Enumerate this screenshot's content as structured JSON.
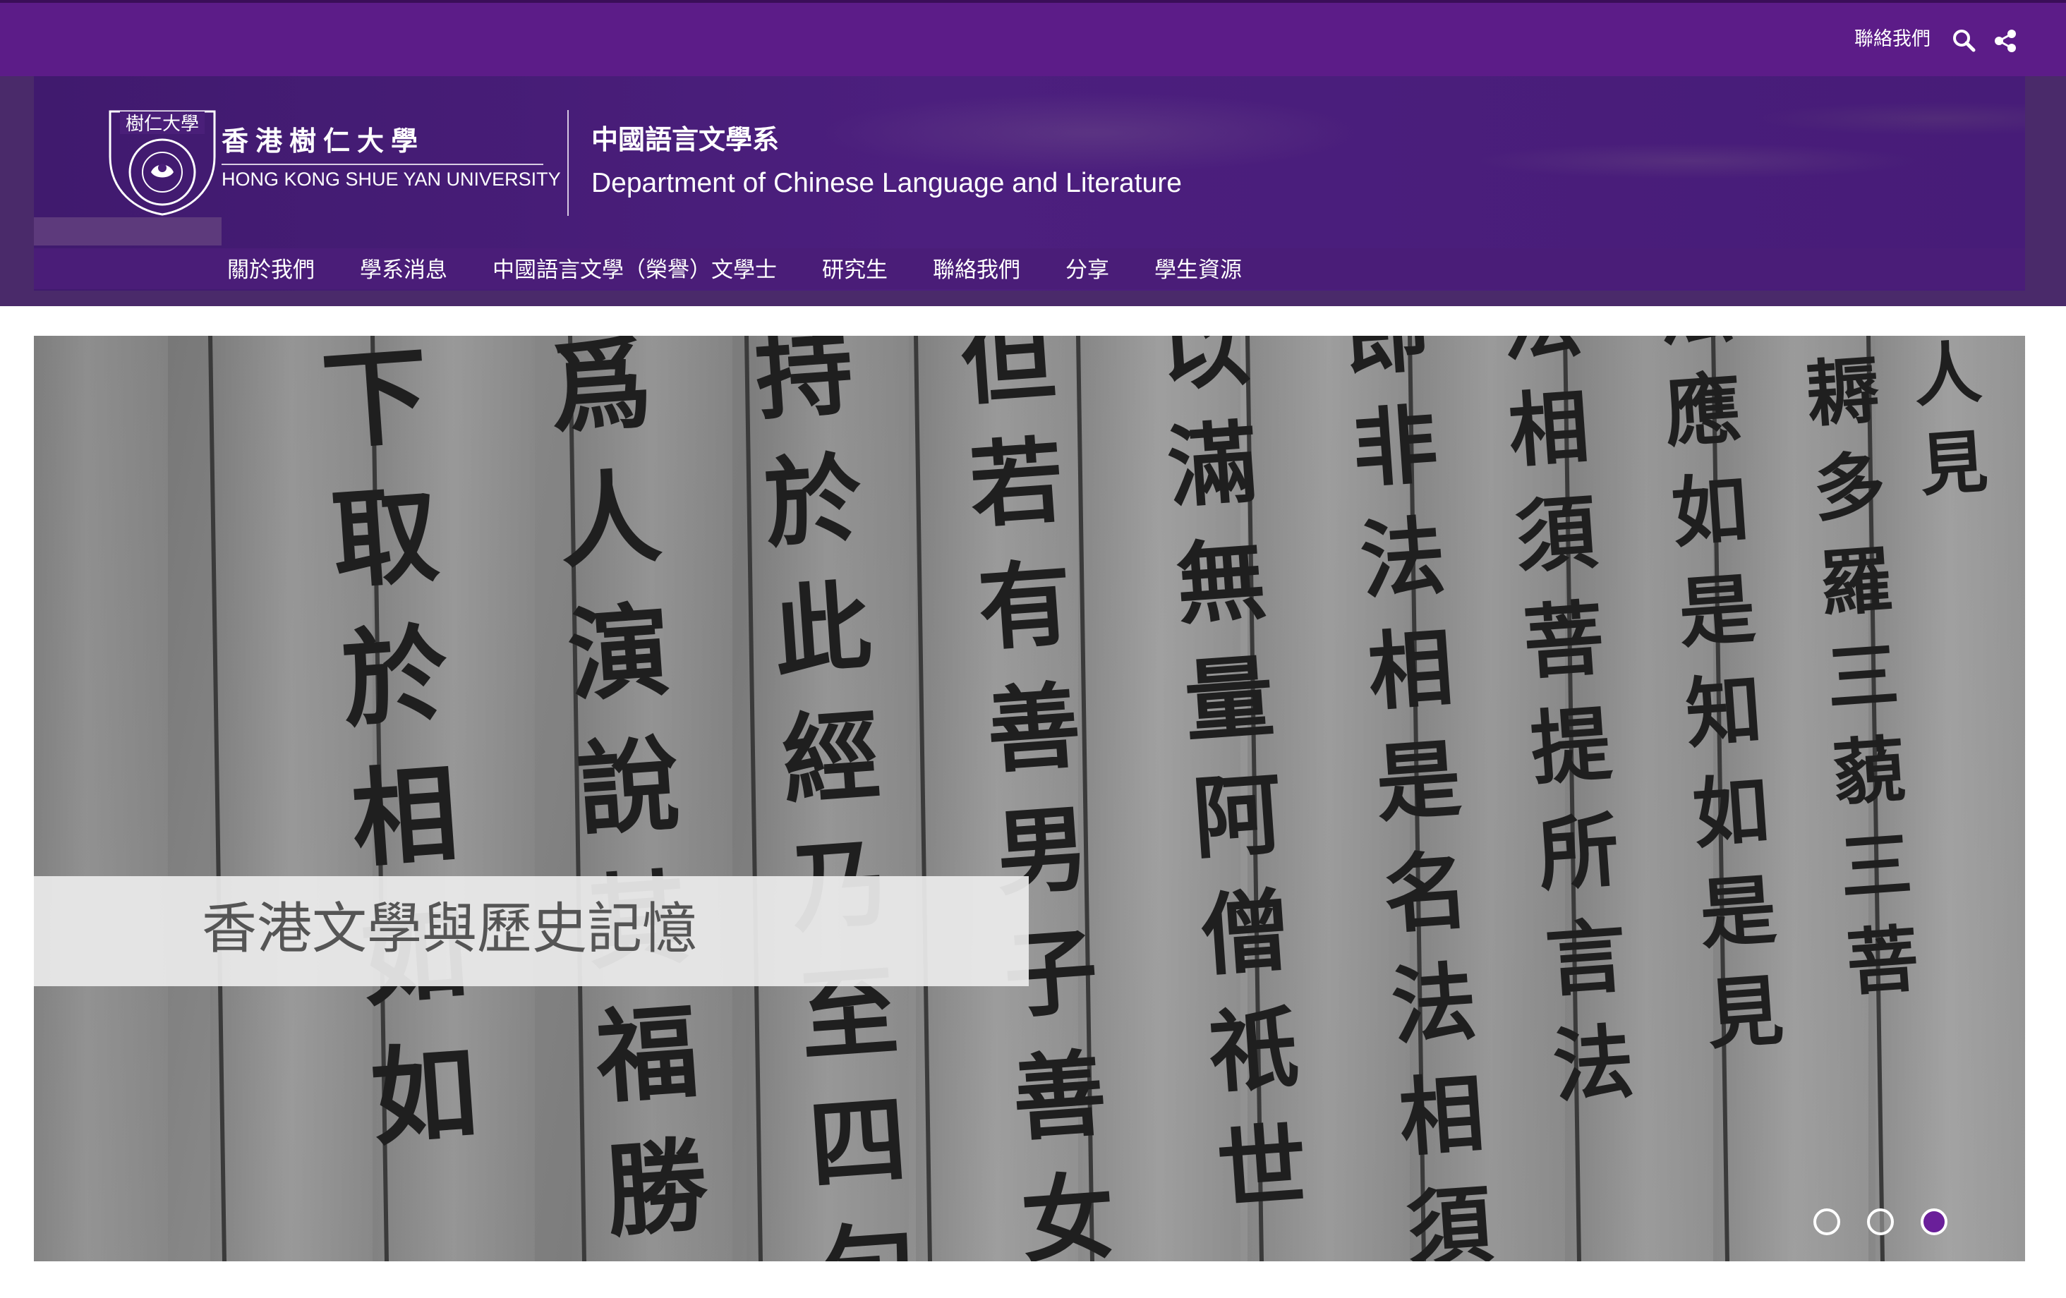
{
  "topbar": {
    "contact_label": "聯絡我們",
    "background": "#5c1c88"
  },
  "header": {
    "logo": {
      "seal_text": "樹仁大學",
      "name_zh": "香港樹仁大學",
      "name_en": "HONG KONG SHUE YAN UNIVERSITY"
    },
    "department_zh": "中國語言文學系",
    "department_en": "Department of Chinese Language and Literature",
    "accent": "#4a1d78"
  },
  "nav": {
    "items": [
      {
        "label": "關於我們"
      },
      {
        "label": "學系消息"
      },
      {
        "label": "中國語言文學（榮譽）文學士"
      },
      {
        "label": "研究生"
      },
      {
        "label": "聯絡我們"
      },
      {
        "label": "分享"
      },
      {
        "label": "學生資源"
      }
    ]
  },
  "hero": {
    "caption": "香港文學與歷史記憶",
    "carved_columns": [
      "下取於相如如",
      "爲人演說其福勝",
      "持於此經乃至四句",
      "但若有善男子善女",
      "以滿無量阿僧祇世",
      "即非法相是名法相須",
      "法相須菩提所言法",
      "法應如是知如是見",
      "阿耨多羅三藐三菩",
      "見人見"
    ],
    "slides": {
      "total": 3,
      "active_index": 3
    },
    "active_dot_color": "#6a1f9a"
  }
}
